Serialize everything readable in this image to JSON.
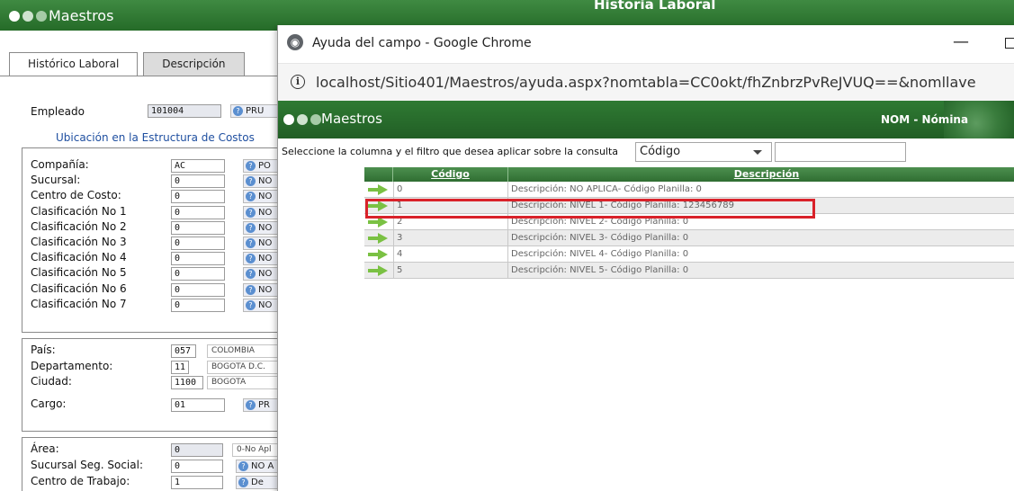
{
  "background_app": {
    "app_title": "Maestros",
    "section_title": "Historia Laboral",
    "tabs": [
      {
        "label": "Histórico Laboral"
      },
      {
        "label": "Descripción"
      }
    ],
    "employee": {
      "label": "Empleado",
      "value": "101004",
      "name": "PRU"
    },
    "cost_structure_heading": "Ubicación en la Estructura de Costos",
    "cost_fields": [
      {
        "label": "Compañía:",
        "value": "AC",
        "tag": "PO"
      },
      {
        "label": "Sucursal:",
        "value": "0",
        "tag": "NO"
      },
      {
        "label": "Centro de Costo:",
        "value": "0",
        "tag": "NO"
      },
      {
        "label": "Clasificación No 1",
        "value": "0",
        "tag": "NO"
      },
      {
        "label": "Clasificación No 2",
        "value": "0",
        "tag": "NO"
      },
      {
        "label": "Clasificación No 3",
        "value": "0",
        "tag": "NO"
      },
      {
        "label": "Clasificación No 4",
        "value": "0",
        "tag": "NO"
      },
      {
        "label": "Clasificación No 5",
        "value": "0",
        "tag": "NO"
      },
      {
        "label": "Clasificación No 6",
        "value": "0",
        "tag": "NO"
      },
      {
        "label": "Clasificación No 7",
        "value": "0",
        "tag": "NO"
      }
    ],
    "location_fields": [
      {
        "label": "País:",
        "value": "057",
        "tag": "COLOMBIA"
      },
      {
        "label": "Departamento:",
        "value": "11",
        "tag": "BOGOTA D.C."
      },
      {
        "label": "Ciudad:",
        "value": "1100",
        "tag": "BOGOTA"
      },
      {
        "label": "Cargo:",
        "value": "01",
        "tag": "PR"
      }
    ],
    "area_fields": [
      {
        "label": "Área:",
        "value": "0",
        "tag": "0-No Apl"
      },
      {
        "label": "Sucursal Seg. Social:",
        "value": "0",
        "tag": "NO A"
      },
      {
        "label": "Centro de Trabajo:",
        "value": "1",
        "tag": "De"
      }
    ]
  },
  "popup": {
    "window_title": "Ayuda del campo - Google Chrome",
    "url": "localhost/Sitio401/Maestros/ayuda.aspx?nomtabla=CC0okt/fhZnbrzPvReJVUQ==&nomllave",
    "header_title": "Maestros",
    "module_label": "NOM - Nómina",
    "filter_prompt": "Seleccione la columna y el filtro que desea aplicar sobre la consulta",
    "filter_column": "Código",
    "filter_value": "",
    "grid": {
      "headers": {
        "code": "Código",
        "description": "Descripción"
      },
      "rows": [
        {
          "code": "0",
          "description": "Descripción: NO APLICA- Código Planilla: 0"
        },
        {
          "code": "1",
          "description": "Descripción: NIVEL 1- Código Planilla: 123456789"
        },
        {
          "code": "2",
          "description": "Descripción: NIVEL 2- Código Planilla: 0"
        },
        {
          "code": "3",
          "description": "Descripción: NIVEL 3- Código Planilla: 0"
        },
        {
          "code": "4",
          "description": "Descripción: NIVEL 4- Código Planilla: 0"
        },
        {
          "code": "5",
          "description": "Descripción: NIVEL 5- Código Planilla: 0"
        }
      ],
      "highlighted_row": "1"
    }
  },
  "colors": {
    "header_green": "#2e7d32",
    "arrow_green": "#7ac143",
    "highlight_red": "#d9222a",
    "link_blue": "#1f4fa0"
  },
  "icons": [
    "chrome-globe-icon",
    "info-icon",
    "minimize-icon",
    "maximize-icon",
    "select-arrow-icon",
    "row-select-arrow-icon",
    "help-badge-icon"
  ]
}
